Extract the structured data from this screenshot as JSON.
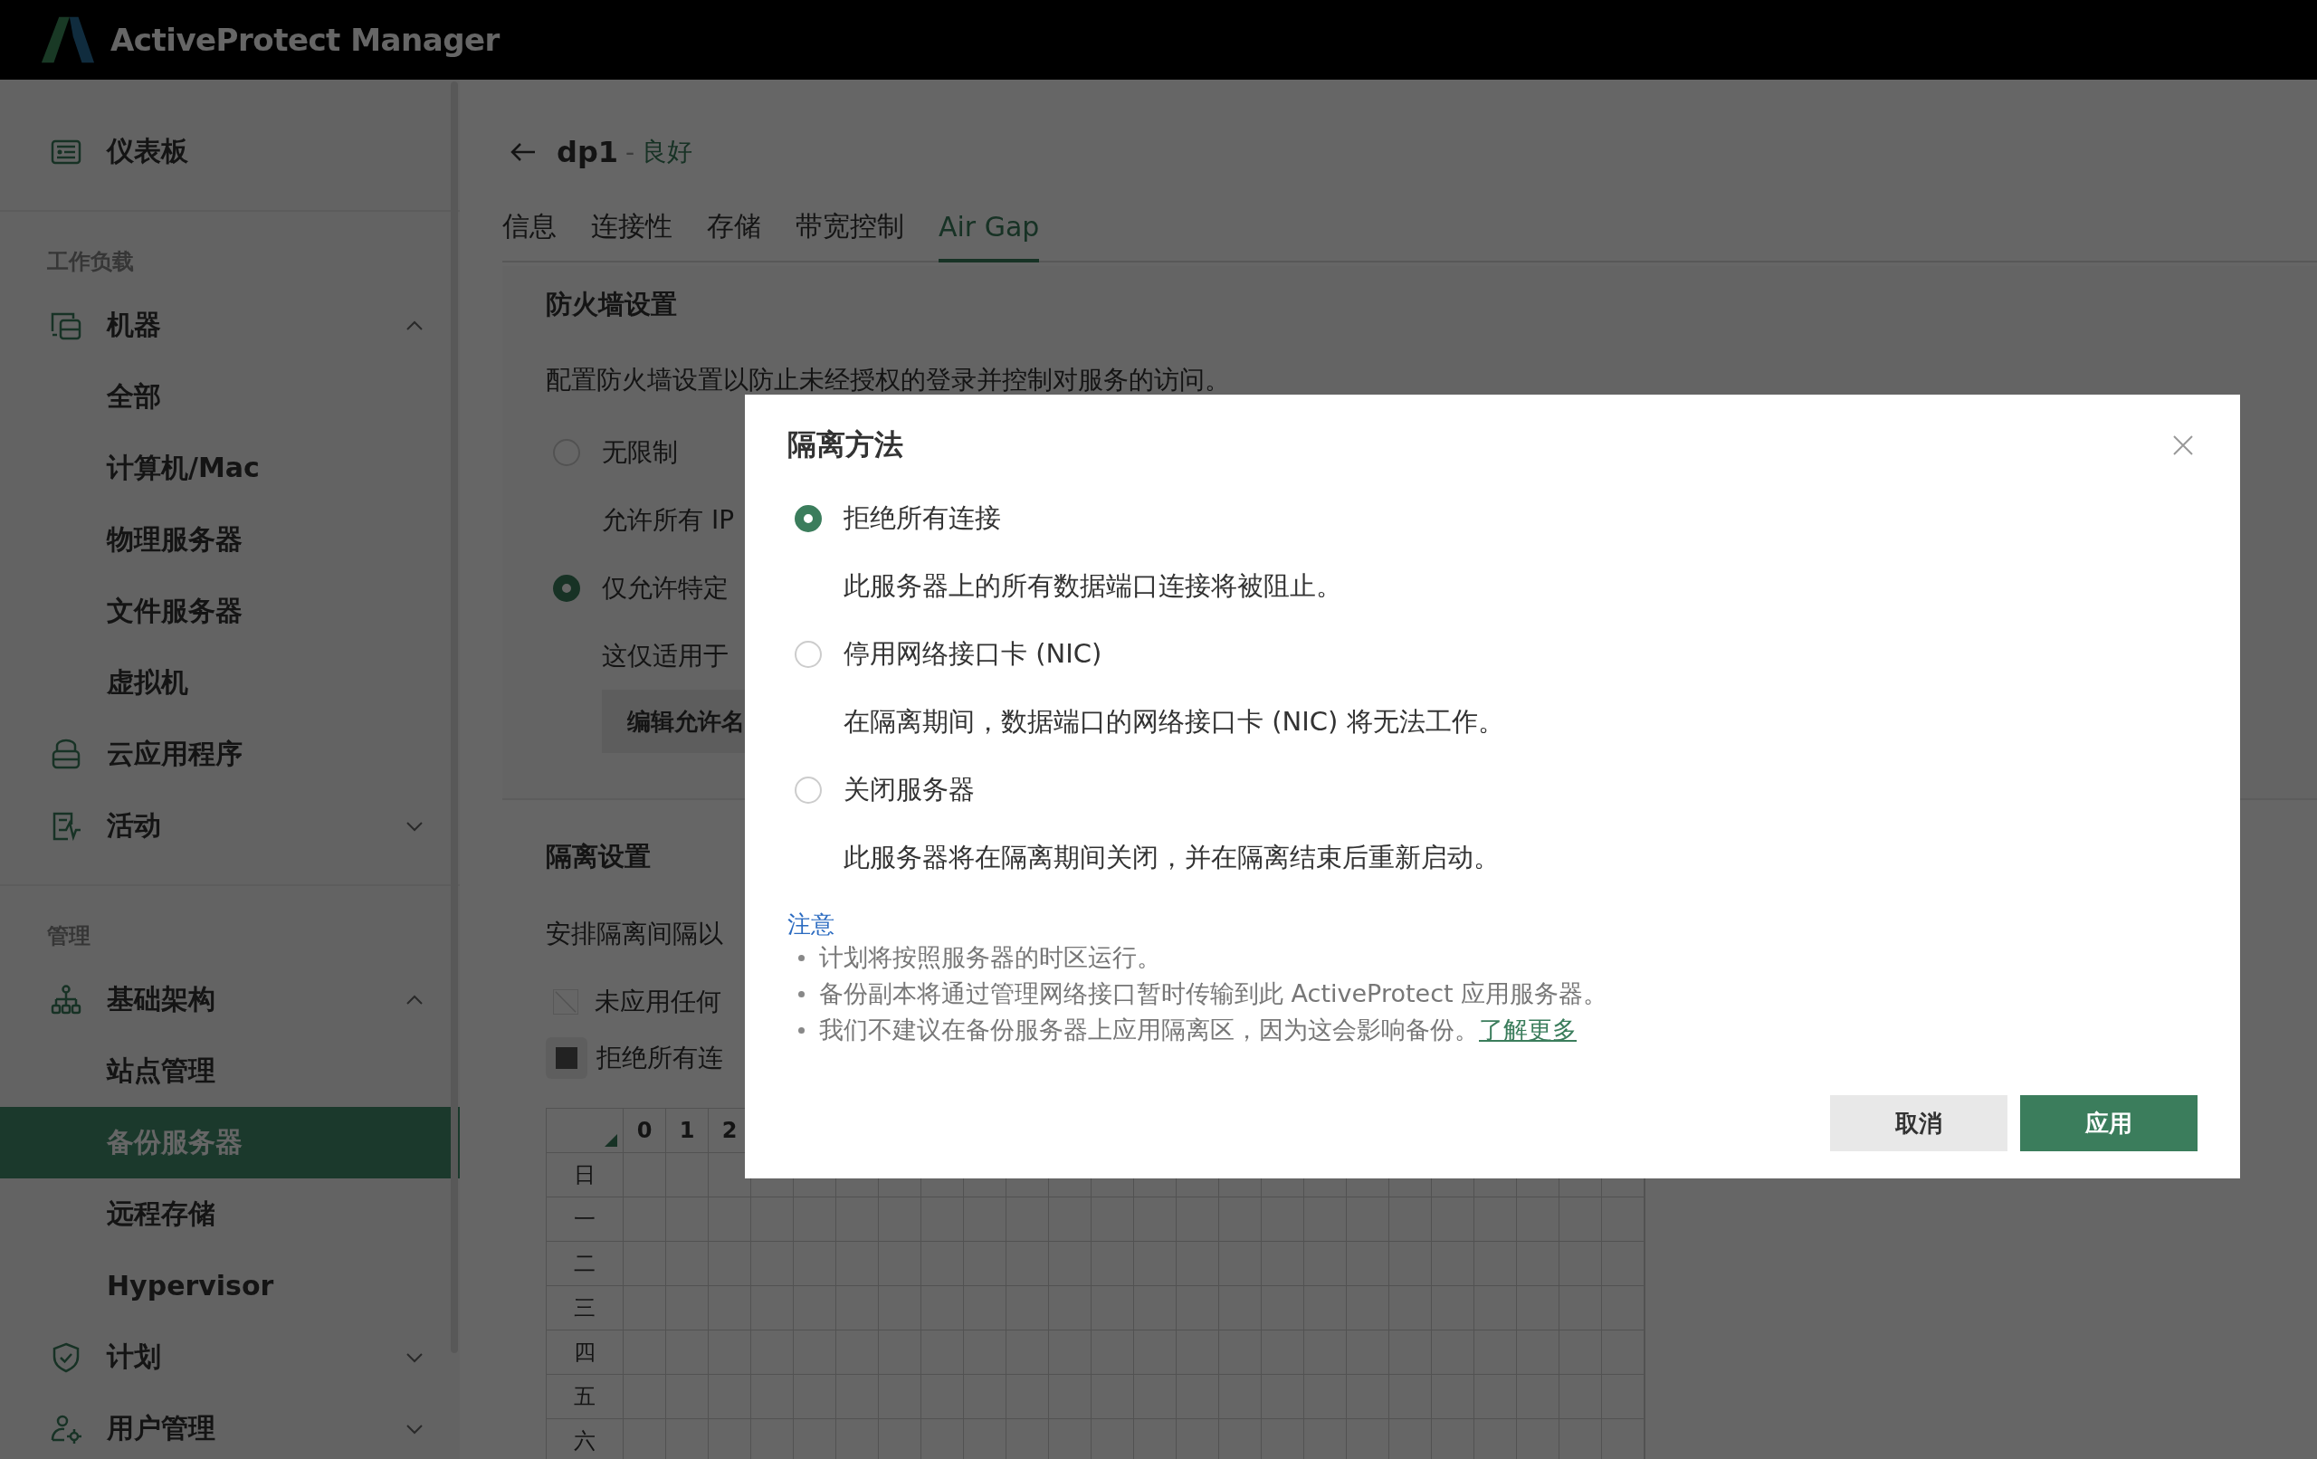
{
  "app": {
    "title": "ActiveProtect Manager"
  },
  "sidebar": {
    "groups": [
      {
        "items": [
          {
            "label": "仪表板",
            "selected": false
          }
        ]
      },
      {
        "heading": "工作负载",
        "items": [
          {
            "label": "机器",
            "selected": false,
            "expanded": true,
            "children": [
              {
                "label": "全部",
                "selected": false
              },
              {
                "label": "计算机/Mac",
                "selected": false
              },
              {
                "label": "物理服务器",
                "selected": false
              },
              {
                "label": "文件服务器",
                "selected": false
              },
              {
                "label": "虚拟机",
                "selected": false
              }
            ]
          },
          {
            "label": "云应用程序",
            "selected": false
          },
          {
            "label": "活动",
            "selected": false,
            "expanded": false
          }
        ]
      },
      {
        "heading": "管理",
        "items": [
          {
            "label": "基础架构",
            "selected": false,
            "expanded": true,
            "children": [
              {
                "label": "站点管理",
                "selected": false
              },
              {
                "label": "备份服务器",
                "selected": true
              },
              {
                "label": "远程存储",
                "selected": false
              },
              {
                "label": "Hypervisor",
                "selected": false
              }
            ]
          },
          {
            "label": "计划",
            "selected": false,
            "expanded": false
          },
          {
            "label": "用户管理",
            "selected": false,
            "expanded": false
          }
        ]
      }
    ]
  },
  "page": {
    "title": "dp1",
    "separator": "-",
    "status": "良好"
  },
  "tabs": [
    {
      "label": "信息",
      "selected": false
    },
    {
      "label": "连接性",
      "selected": false
    },
    {
      "label": "存储",
      "selected": false
    },
    {
      "label": "带宽控制",
      "selected": false
    },
    {
      "label": "Air Gap",
      "selected": true
    }
  ],
  "firewall": {
    "heading": "防火墙设置",
    "description": "配置防火墙设置以防止未经授权的登录并控制对服务的访问。",
    "options": [
      {
        "label": "无限制",
        "selected": false,
        "note": "允许所有 IP"
      },
      {
        "label": "仅允许特定",
        "selected": true,
        "note": "这仅适用于"
      }
    ],
    "button": "编辑允许名"
  },
  "isolation": {
    "heading": "隔离设置",
    "description": "安排隔离间隔以",
    "legend": [
      {
        "kind": "none",
        "label": "未应用任何"
      },
      {
        "kind": "deny",
        "label": "拒绝所有连"
      }
    ],
    "schedule": {
      "hours": [
        "0",
        "1",
        "2"
      ],
      "days": [
        "日",
        "一",
        "二",
        "三",
        "四",
        "五",
        "六"
      ]
    }
  },
  "dialog": {
    "title": "隔离方法",
    "options": [
      {
        "label": "拒绝所有连接",
        "description": "此服务器上的所有数据端口连接将被阻止。",
        "selected": true
      },
      {
        "label": "停用网络接口卡 (NIC)",
        "description": "在隔离期间，数据端口的网络接口卡 (NIC) 将无法工作。",
        "selected": false
      },
      {
        "label": "关闭服务器",
        "description": "此服务器将在隔离期间关闭，并在隔离结束后重新启动。",
        "selected": false
      }
    ],
    "note_title": "注意",
    "notes": [
      {
        "text": "计划将按照服务器的时区运行。"
      },
      {
        "text": "备份副本将通过管理网络接口暂时传输到此 ActiveProtect 应用服务器。"
      },
      {
        "text": "我们不建议在备份服务器上应用隔离区，因为这会影响备份。",
        "link": "了解更多"
      }
    ],
    "buttons": [
      {
        "kind": "secondary",
        "label": "取消"
      },
      {
        "kind": "primary",
        "label": "应用"
      }
    ]
  }
}
